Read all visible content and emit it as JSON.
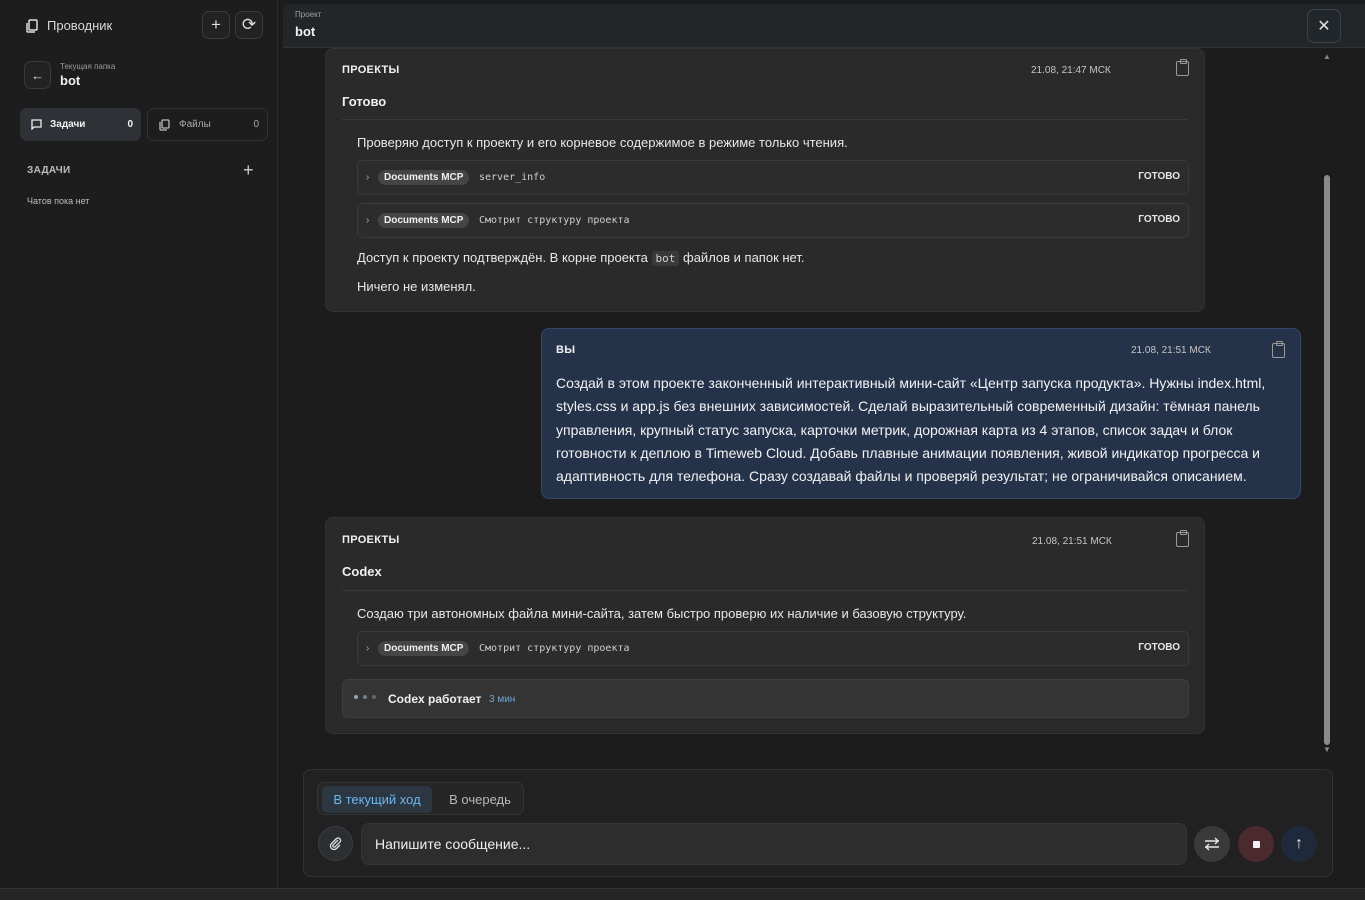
{
  "sidebar": {
    "title": "Проводник",
    "current_folder_label": "Текущая папка",
    "current_folder": "bot",
    "tabs": [
      {
        "label": "Задачи",
        "count": "0"
      },
      {
        "label": "Файлы",
        "count": "0"
      }
    ],
    "tasks_heading": "ЗАДАЧИ",
    "empty_text": "Чатов пока нет"
  },
  "header": {
    "project_label": "Проект",
    "project_name": "bot"
  },
  "messages": [
    {
      "author": "ПРОЕКТЫ",
      "time": "21.08, 21:47 МСК",
      "status": "Готово",
      "intro": "Проверяю доступ к проекту и его корневое содержимое в режиме только чтения.",
      "tools": [
        {
          "badge": "Documents MCP",
          "name": "server_info",
          "status": "ГОТОВО"
        },
        {
          "badge": "Documents MCP",
          "name": "Смотрит структуру проекта",
          "status": "ГОТОВО"
        }
      ],
      "result_before": "Доступ к проекту подтверждён. В корне проекта",
      "result_code": "bot",
      "result_after": "файлов и папок нет.",
      "note": "Ничего не изменял."
    },
    {
      "author": "ВЫ",
      "time": "21.08, 21:51 МСК",
      "text": "Создай в этом проекте законченный интерактивный мини-сайт «Центр запуска продукта». Нужны index.html, styles.css и app.js без внешних зависимостей. Сделай выразительный современный дизайн: тёмная панель управления, крупный статус запуска, карточки метрик, дорожная карта из 4 этапов, список задач и блок готовности к деплою в Timeweb Cloud. Добавь плавные анимации появления, живой индикатор прогресса и адаптивность для телефона. Сразу создавай файлы и проверяй результат; не ограничивайся описанием."
    },
    {
      "author": "ПРОЕКТЫ",
      "time": "21.08, 21:51 МСК",
      "status": "Codex",
      "intro": "Создаю три автономных файла мини-сайта, затем быстро проверю их наличие и базовую структуру.",
      "tools": [
        {
          "badge": "Documents MCP",
          "name": "Смотрит структуру проекта",
          "status": "ГОТОВО"
        }
      ],
      "working_label": "Codex работает",
      "working_time": "3 мин"
    }
  ],
  "composer": {
    "modes": [
      "В текущий ход",
      "В очередь"
    ],
    "placeholder": "Напишите сообщение..."
  }
}
